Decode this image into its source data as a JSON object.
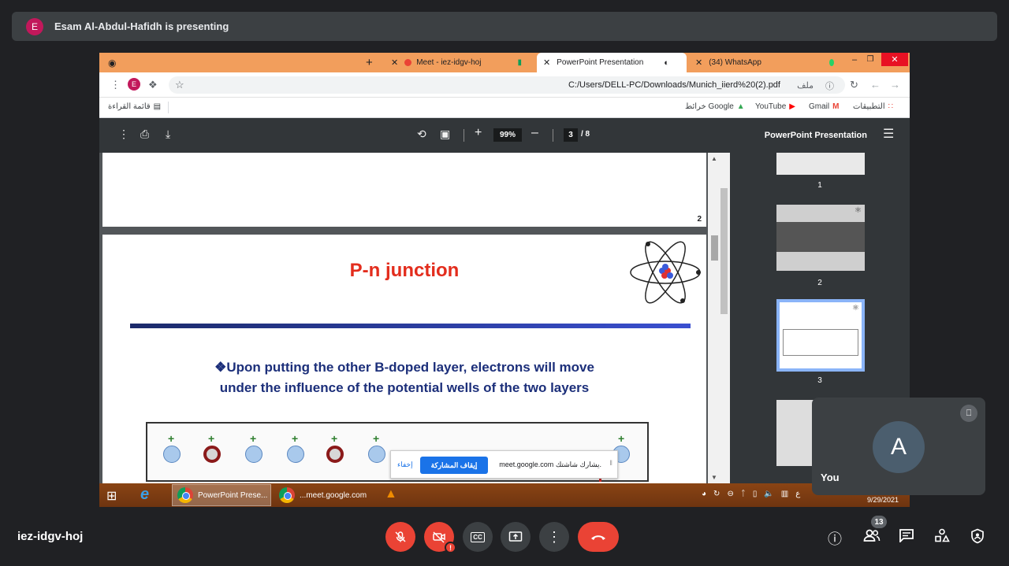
{
  "banner": {
    "avatar_letter": "E",
    "presenting_text": "Esam Al-Abdul-Hafidh is presenting"
  },
  "browser": {
    "tabs": [
      {
        "title": "Meet - iez-idgv-hoj",
        "active": false
      },
      {
        "title": "PowerPoint Presentation",
        "active": true
      },
      {
        "title": "(34) WhatsApp",
        "active": false
      }
    ],
    "profile_letter": "E",
    "url": "C:/Users/DELL-PC/Downloads/Munich_iierd%20(2).pdf",
    "url_prefix": "ملف",
    "bookmarks": {
      "apps": "التطبيقات",
      "gmail": "Gmail",
      "youtube": "YouTube",
      "maps": "خرائط Google",
      "reading_list": "قائمة القراءة"
    }
  },
  "pdf_viewer": {
    "zoom": "99%",
    "current_page": "3",
    "total_pages": "/ 8",
    "title": "PowerPoint Presentation",
    "page2_number": "2",
    "slide_title": "P-n junction",
    "slide_body_line1": "❖Upon putting the other B-doped layer, electrons will move",
    "slide_body_line2": "under the influence of the potential wells of the two layers",
    "thumbnails": [
      "1",
      "2",
      "3"
    ]
  },
  "share_notice": {
    "message": "meet.google.com يشارك شاشتك.",
    "stop_button": "إيقاف المشاركة",
    "hide_link": "إخفاء"
  },
  "taskbar": {
    "apps": [
      {
        "label": "PowerPoint Prese...",
        "active": true
      },
      {
        "label": "...meet.google.com",
        "active": false
      }
    ],
    "date": "9/29/2021"
  },
  "self_tile": {
    "avatar_letter": "A",
    "label": "You"
  },
  "meet_bar": {
    "meeting_code": "iez-idgv-hoj",
    "participants_count": "13"
  },
  "colors": {
    "tabstrip": "#f29e5c",
    "slide_title": "#e32d1d",
    "end_call": "#ea4335",
    "share_button": "#1a73e8"
  }
}
